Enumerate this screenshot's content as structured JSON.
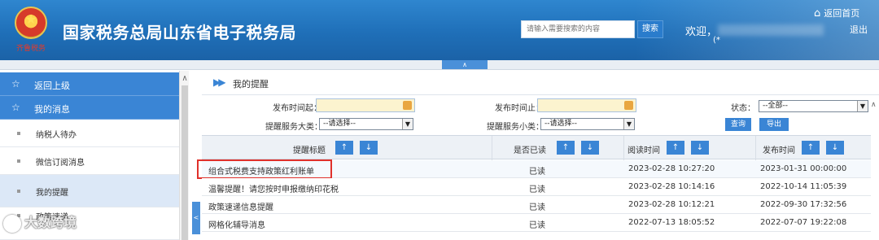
{
  "header": {
    "site_title": "国家税务总局山东省电子税务局",
    "brand_text": "齐鲁税务",
    "search_placeholder": "请输入需要搜索的内容",
    "search_button": "搜索",
    "welcome": "欢迎，",
    "user_sub": "(*",
    "home_link": "返回首页",
    "logout": "退出"
  },
  "collapse_tab": "∧",
  "sidebar": {
    "back": "返回上级",
    "section": "我的消息",
    "items": [
      {
        "label": "纳税人待办"
      },
      {
        "label": "微信订阅消息"
      },
      {
        "label": "我的提醒"
      },
      {
        "label": "政策速递"
      }
    ]
  },
  "main": {
    "title": "我的提醒",
    "filters": {
      "pub_from_label": "发布时间起：",
      "pub_to_label": "发布时间止：",
      "status_label": "状态：",
      "status_value": "--全部--",
      "service_major_label": "提醒服务大类：",
      "service_major_value": "--请选择--",
      "service_minor_label": "提醒服务小类：",
      "service_minor_value": "--请选择--",
      "query_button": "查询",
      "export_button": "导出"
    },
    "columns": [
      "提醒标题",
      "是否已读",
      "阅读时间",
      "发布时间"
    ],
    "rows": [
      {
        "title": "组合式税费支持政策红利账单",
        "read": "已读",
        "read_time": "2023-02-28 10:27:20",
        "pub_time": "2023-01-31 00:00:00"
      },
      {
        "title": "温馨提醒！请您按时申报缴纳印花税",
        "read": "已读",
        "read_time": "2023-02-28 10:14:16",
        "pub_time": "2022-10-14 11:05:39"
      },
      {
        "title": "政策速递信息提醒",
        "read": "已读",
        "read_time": "2023-02-28 10:12:21",
        "pub_time": "2022-09-30 17:32:56"
      },
      {
        "title": "网格化辅导消息",
        "read": "已读",
        "read_time": "2022-07-13 18:05:52",
        "pub_time": "2022-07-07 19:22:08"
      }
    ]
  },
  "watermark": "大数跨境",
  "colors": {
    "header": "#1f6fb8",
    "accent": "#3a85d5",
    "highlight_box": "#e0312b"
  }
}
